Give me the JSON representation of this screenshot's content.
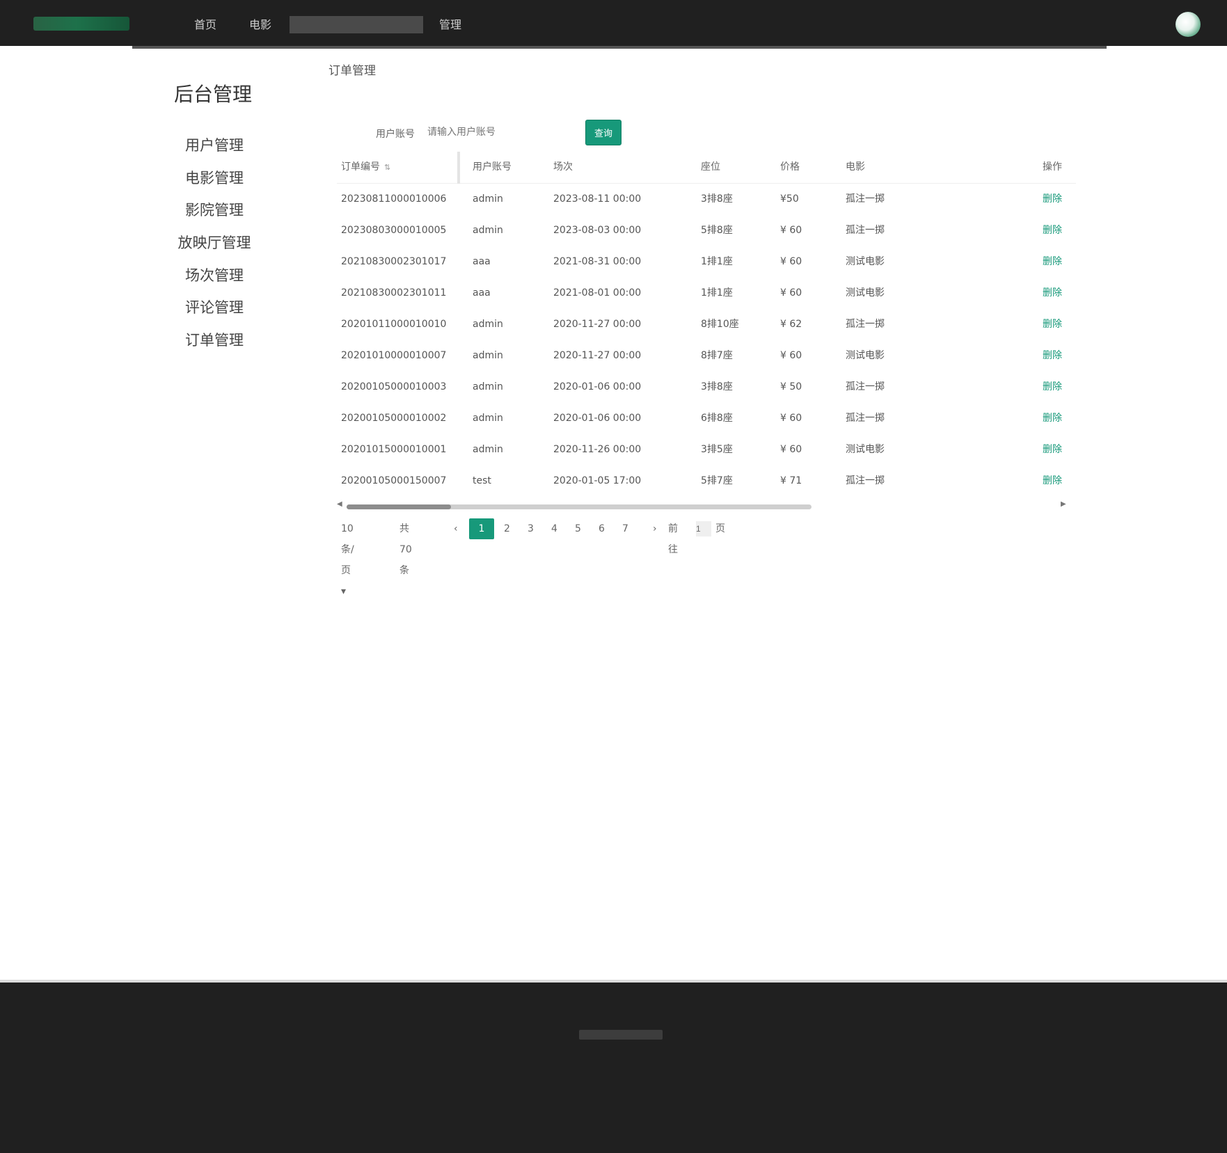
{
  "header": {
    "nav": [
      "首页",
      "电影",
      "管理"
    ],
    "search_placeholder": ""
  },
  "sidebar": {
    "title": "后台管理",
    "items": [
      "用户管理",
      "电影管理",
      "影院管理",
      "放映厅管理",
      "场次管理",
      "评论管理",
      "订单管理"
    ]
  },
  "breadcrumb": "订单管理",
  "search": {
    "label": "用户账号",
    "placeholder": "请输入用户账号",
    "button": "查询"
  },
  "table": {
    "headers": [
      "订单编号",
      "用户账号",
      "场次",
      "座位",
      "价格",
      "电影",
      "操作"
    ],
    "rows": [
      [
        "20230811000010006",
        "admin",
        "2023-08-11 00:00",
        "3排8座",
        "¥50",
        "孤注一掷",
        "删除"
      ],
      [
        "20230803000010005",
        "admin",
        "2023-08-03 00:00",
        "5排8座",
        "¥ 60",
        "孤注一掷",
        "删除"
      ],
      [
        "20210830002301017",
        "aaa",
        "2021-08-31 00:00",
        "1排1座",
        "¥ 60",
        "测试电影",
        "删除"
      ],
      [
        "20210830002301011",
        "aaa",
        "2021-08-01 00:00",
        "1排1座",
        "¥ 60",
        "测试电影",
        "删除"
      ],
      [
        "20201011000010010",
        "admin",
        "2020-11-27 00:00",
        "8排10座",
        "¥ 62",
        "孤注一掷",
        "删除"
      ],
      [
        "20201010000010007",
        "admin",
        "2020-11-27 00:00",
        "8排7座",
        "¥ 60",
        "测试电影",
        "删除"
      ],
      [
        "20200105000010003",
        "admin",
        "2020-01-06 00:00",
        "3排8座",
        "¥ 50",
        "孤注一掷",
        "删除"
      ],
      [
        "20200105000010002",
        "admin",
        "2020-01-06 00:00",
        "6排8座",
        "¥ 60",
        "孤注一掷",
        "删除"
      ],
      [
        "20201015000010001",
        "admin",
        "2020-11-26 00:00",
        "3排5座",
        "¥ 60",
        "测试电影",
        "删除"
      ],
      [
        "20200105000150007",
        "test",
        "2020-01-05 17:00",
        "5排7座",
        "¥ 71",
        "孤注一掷",
        "删除"
      ]
    ]
  },
  "pager": {
    "page_size": "10条/页",
    "total": "共70条",
    "pages": [
      "1",
      "2",
      "3",
      "4",
      "5",
      "6",
      "7"
    ],
    "active_page": "1",
    "goto_label": "前往",
    "goto_value": "1",
    "goto_suffix": "页"
  },
  "colors": {
    "header_bg": "#202020",
    "accent": "#17997a",
    "footer_bg": "#202020"
  }
}
